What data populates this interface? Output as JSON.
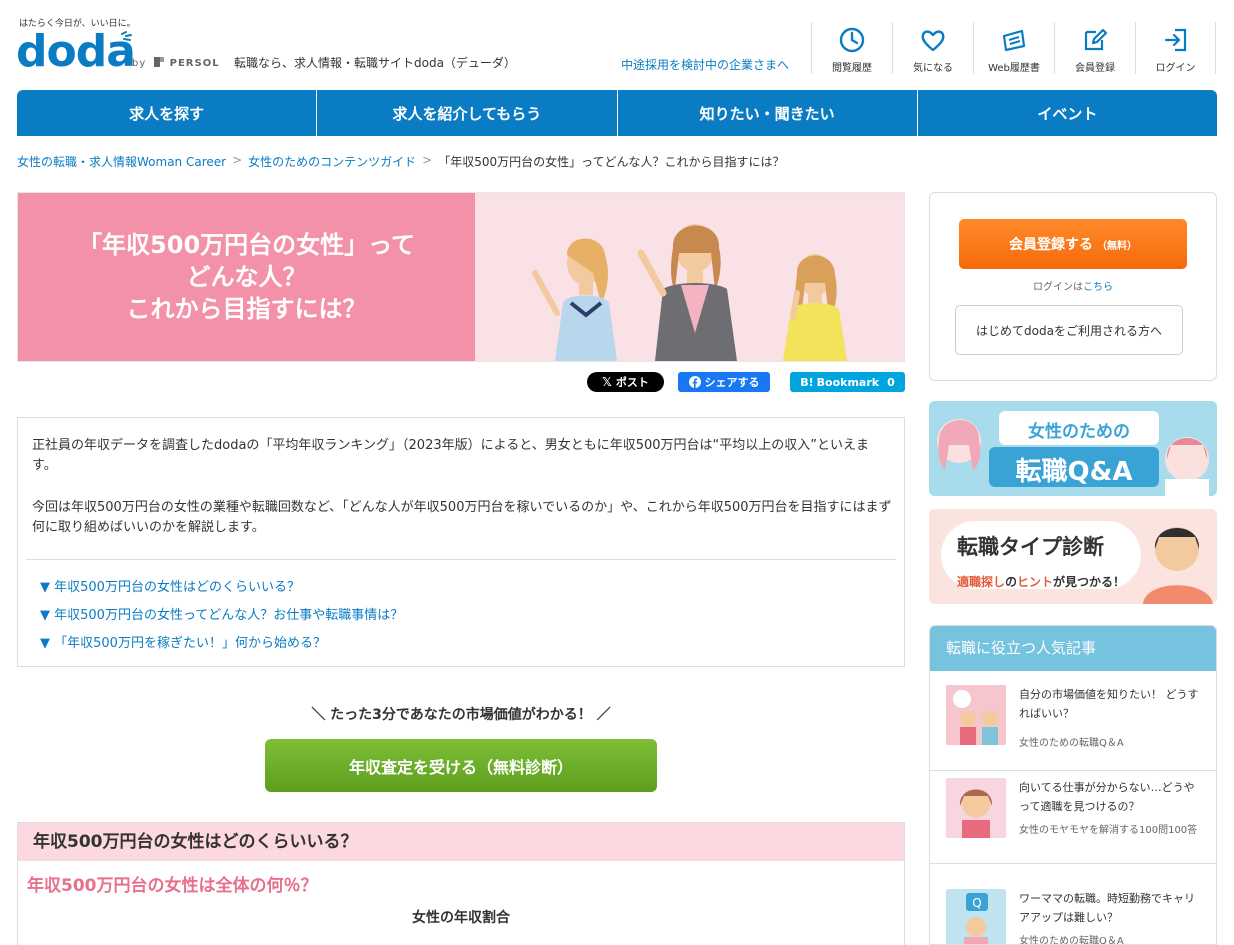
{
  "header": {
    "tagline": "はたらく今日が、いい日に。",
    "logo": "doda",
    "by": "by",
    "persol": "PERSOL",
    "description": "転職なら、求人情報・転職サイトdoda（デューダ）",
    "corp_link": "中途採用を検討中の企業さまへ",
    "nav": [
      {
        "label": "閲覧履歴",
        "icon": "clock-icon"
      },
      {
        "label": "気になる",
        "icon": "heart-icon"
      },
      {
        "label": "Web履歴書",
        "icon": "resume-icon"
      },
      {
        "label": "会員登録",
        "icon": "edit-icon"
      },
      {
        "label": "ログイン",
        "icon": "login-icon"
      }
    ]
  },
  "main_nav": [
    "求人を探す",
    "求人を紹介してもらう",
    "知りたい・聞きたい",
    "イベント"
  ],
  "breadcrumb": {
    "items": [
      "女性の転職・求人情報Woman Career",
      "女性のためのコンテンツガイド"
    ],
    "current": "「年収500万円台の女性」ってどんな人？これから目指すには？",
    "sep": ">"
  },
  "hero": {
    "title": "「年収500万円台の女性」って\nどんな人？\nこれから目指すには？"
  },
  "share": {
    "x": "ポスト",
    "facebook": "シェアする",
    "hatena": "Bookmark",
    "hatena_count": "0"
  },
  "intro": {
    "p1": "正社員の年収データを調査したdodaの「平均年収ランキング」（2023年版）によると、男女ともに年収500万円台は“平均以上の収入”といえます。",
    "p2": "今回は年収500万円台の女性の業種や転職回数など、「どんな人が年収500万円台を稼いでいるのか」や、これから年収500万円台を目指すにはまず何に取り組めばいいのかを解説します。",
    "toc": [
      "▼ 年収500万円台の女性はどのくらいいる？",
      "▼ 年収500万円台の女性ってどんな人？お仕事や転職事情は？",
      "▼ 「年収500万円を稼ぎたい！」何から始める？"
    ]
  },
  "cta": {
    "caption": "＼ たった3分であなたの市場価値がわかる！ ／",
    "button": "年収査定を受ける（無料診断）"
  },
  "section": {
    "heading": "年収500万円台の女性はどのくらいいる？",
    "subheading": "年収500万円台の女性は全体の何％？",
    "chart_title": "女性の年収割合"
  },
  "sidebar": {
    "register": "会員登録する",
    "register_note": "（無料）",
    "login_prefix": "ログインは",
    "login_link": "こちら",
    "first_time": "はじめてdodaをご利用される方へ",
    "banner_qa": {
      "line1": "女性のための",
      "line2": "転職Q&A"
    },
    "banner_type": {
      "title": "転職タイプ診断",
      "sub_a": "適職探し",
      "sub_b": "の",
      "sub_c": "ヒント",
      "sub_d": "が見つかる！"
    },
    "popular_heading": "転職に役立つ人気記事",
    "popular": [
      {
        "title": "自分の市場価値を知りたい！ どうすればいい？",
        "category": "女性のための転職Q＆A"
      },
      {
        "title": "向いてる仕事が分からない…どうやって適職を見つけるの？",
        "category": "女性のモヤモヤを解消する100問100答"
      },
      {
        "title": "ワーママの転職。時短勤務でキャリアアップは難しい？",
        "category": "女性のための転職Q＆A"
      }
    ]
  },
  "colors": {
    "brand": "#0a7cc4",
    "pink": "#f291a7",
    "green": "#6aaf28",
    "orange": "#f57a1c"
  }
}
